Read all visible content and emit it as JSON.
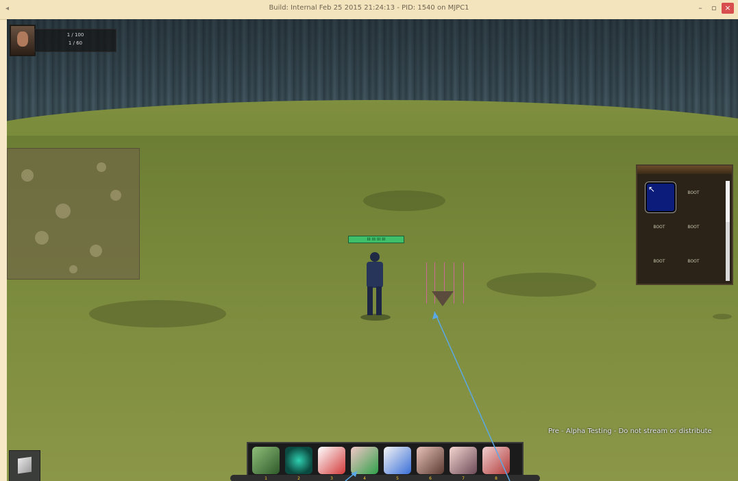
{
  "window": {
    "title": "Build: Internal Feb 25 2015 21:24:13 - PID: 1540 on MJPC1",
    "buttons": {
      "minimize": "–",
      "maximize": "▫",
      "close": "×"
    }
  },
  "player": {
    "status_line_1": "1 / 100",
    "status_line_2": "1 / 60"
  },
  "character": {
    "nameplate": "III III III III"
  },
  "bag": {
    "slots": [
      {
        "icon": "cursor-icon",
        "label": ""
      },
      {
        "label": "BOOT"
      },
      {
        "label": "BOOT"
      },
      {
        "label": "BOOT"
      },
      {
        "label": "BOOT"
      },
      {
        "label": "BOOT"
      }
    ]
  },
  "watermark": "Pre - Alpha Testing - Do not stream or distribute",
  "action_bar": {
    "skills": [
      {
        "icon": "green-cube-icon",
        "key": "1"
      },
      {
        "icon": "teal-orb-icon",
        "key": "2"
      },
      {
        "icon": "red-bracket-icon",
        "key": "3"
      },
      {
        "icon": "green-bracket-icon",
        "key": "4"
      },
      {
        "icon": "blue-bracket-icon",
        "key": "5"
      },
      {
        "icon": "brown-cube-icon",
        "key": "6"
      },
      {
        "icon": "arrow-cube-icon",
        "key": "7"
      },
      {
        "icon": "red-cube-icon",
        "key": "8"
      }
    ]
  },
  "colors": {
    "health_bar": "#3fbf6a",
    "target_marker": "#e060b0",
    "annotation_arrow": "#5aa9e6",
    "bag_slot_active": "#0c1c7a"
  }
}
